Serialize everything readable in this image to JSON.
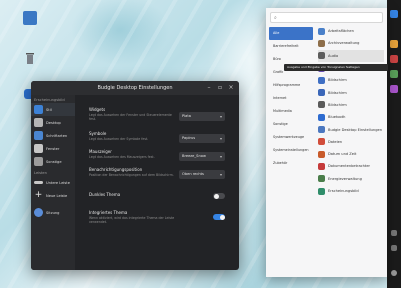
{
  "desktop": {
    "icons": [
      {
        "label": "",
        "color": "#3a78c4"
      },
      {
        "label": "",
        "color": "#7a7f87"
      },
      {
        "label": "",
        "color": "#2a6fcf"
      }
    ]
  },
  "settings": {
    "title": "Budgie Desktop Einstellungen",
    "sidebar_section_1": "Erscheinungsbild",
    "sidebar_section_2": "Leisten",
    "sidebar": [
      {
        "label": "Stil",
        "color": "#3d82d6",
        "active": true
      },
      {
        "label": "Desktop",
        "color": "#b5b5b5"
      },
      {
        "label": "Schriftarten",
        "color": "#4a86d1"
      },
      {
        "label": "Fenster",
        "color": "#c7c7c7"
      },
      {
        "label": "Sonstige",
        "color": "#9c9c9c"
      }
    ],
    "sidebar_panels": [
      {
        "label": "Untere Leiste",
        "color": "#c8c8c8"
      },
      {
        "label": "Neue Leiste",
        "color": "#e6e6e6"
      }
    ],
    "sidebar_bottom": {
      "label": "Sitzung",
      "color": "#5a8dd8"
    },
    "rows": [
      {
        "title": "Widgets",
        "desc": "Legt das Aussehen der Fenster und Steuerelemente fest.",
        "value": "Plata"
      },
      {
        "title": "Symbole",
        "desc": "Legt das Aussehen der Symbole fest.",
        "value": "Papirus"
      },
      {
        "title": "Mauszeiger",
        "desc": "Legt das Aussehen des Mauszeigers fest.",
        "value": "Breeze_Snow"
      },
      {
        "title": "Benachrichtigungsposition",
        "desc": "Position der Benachrichtigungen auf dem Bildschirm.",
        "value": "Oben rechts"
      }
    ],
    "dark_theme_label": "Dunkles Thema",
    "dark_theme_on": false,
    "builtin_label": "Integriertes Thema",
    "builtin_desc": "Wenn aktiviert, wird das integrierte Thema der Leiste verwendet.",
    "builtin_on": true,
    "accent": "#3584e4"
  },
  "launcher": {
    "search_placeholder": "",
    "categories": [
      {
        "label": "Alle",
        "active": true
      },
      {
        "label": "Barrierefreiheit"
      },
      {
        "label": "Büro"
      },
      {
        "label": "Grafik"
      },
      {
        "label": "Hilfsprogramme"
      },
      {
        "label": "Internet"
      },
      {
        "label": "Multimedia"
      },
      {
        "label": "Sonstige"
      },
      {
        "label": "Systemwerkzeuge"
      },
      {
        "label": "Systemeinstellungen"
      },
      {
        "label": "Zubehör"
      }
    ],
    "apps": [
      {
        "label": "Arbeitsflächen",
        "color": "#4a80c9"
      },
      {
        "label": "Archivverwaltung",
        "color": "#8d6e4a"
      },
      {
        "label": "Audio",
        "color": "#5c5c5c",
        "highlight": true
      },
      {
        "label": "Aufgaben",
        "color": "#6a4fb3"
      },
      {
        "label": "Bildschirm",
        "color": "#3f6fc4"
      },
      {
        "label": "Bildschirm",
        "color": "#3a66b8"
      },
      {
        "label": "Bildschirm",
        "color": "#5a5a5a"
      },
      {
        "label": "Bluetooth",
        "color": "#2d6bd0"
      },
      {
        "label": "Budgie Desktop Einstellungen",
        "color": "#4c78c0"
      },
      {
        "label": "Dateien",
        "color": "#d14c3a"
      },
      {
        "label": "Datum und Zeit",
        "color": "#c85a2a"
      },
      {
        "label": "Dokumentenbetrachter",
        "color": "#c53a3a"
      },
      {
        "label": "Energieverwaltung",
        "color": "#4a7d4a"
      },
      {
        "label": "Erscheinungsbild",
        "color": "#2f8d6a"
      }
    ],
    "tooltip": "Ausgabe und Eingabe von Tonsignalen festlegen"
  },
  "panel": {
    "clock": "",
    "icon_colors": [
      "#3584e4",
      "#e8a33b",
      "#c44",
      "#5aa05a",
      "#aa55cc"
    ]
  }
}
